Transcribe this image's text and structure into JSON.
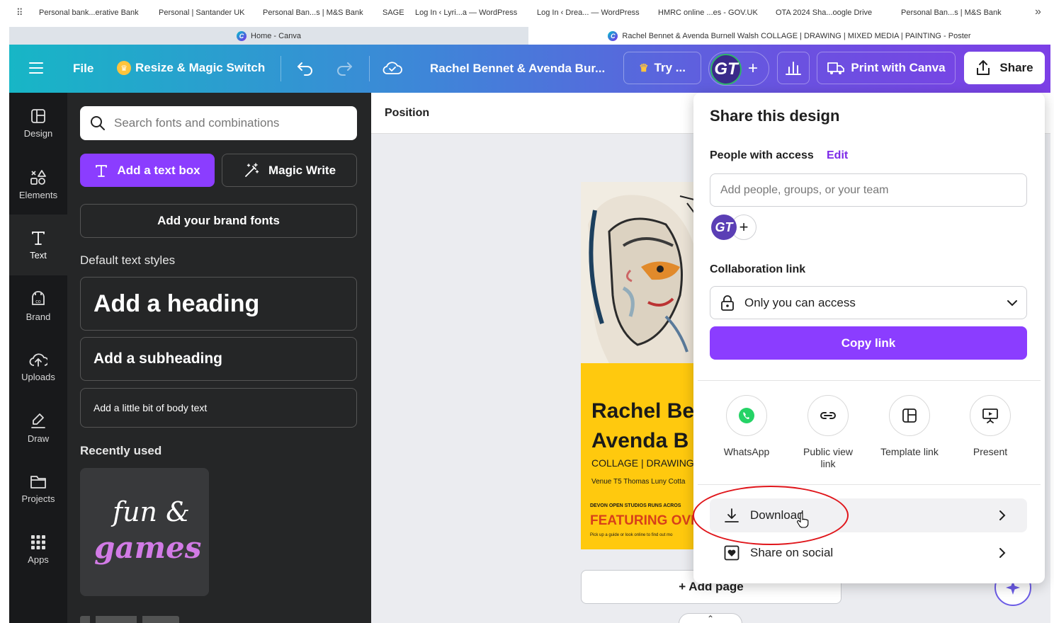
{
  "bookmarks": [
    "Personal bank...erative Bank",
    "Personal | Santander UK",
    "Personal Ban...s | M&S Bank",
    "SAGE",
    "Log In ‹ Lyri...a — WordPress",
    "Log In ‹ Drea... — WordPress",
    "HMRC online ...es - GOV.UK",
    "OTA 2024 Sha...oogle Drive",
    "Personal Ban...s | M&S Bank"
  ],
  "bookmarks_more": "»",
  "tabs": [
    {
      "title": "Home - Canva",
      "active": false
    },
    {
      "title": "Rachel Bennet & Avenda Burnell Walsh COLLAGE | DRAWING | MIXED MEDIA | PAINTING - Poster",
      "active": true
    }
  ],
  "header": {
    "file": "File",
    "resize": "Resize & Magic Switch",
    "doc_title": "Rachel Bennet & Avenda Bur...",
    "try": "Try ...",
    "avatar": "GT",
    "print": "Print with Canva",
    "share": "Share"
  },
  "rail": [
    {
      "label": "Design",
      "icon": "design-icon",
      "active": false
    },
    {
      "label": "Elements",
      "icon": "elements-icon",
      "active": false
    },
    {
      "label": "Text",
      "icon": "text-icon",
      "active": true
    },
    {
      "label": "Brand",
      "icon": "brand-icon",
      "active": false
    },
    {
      "label": "Uploads",
      "icon": "uploads-icon",
      "active": false
    },
    {
      "label": "Draw",
      "icon": "draw-icon",
      "active": false
    },
    {
      "label": "Projects",
      "icon": "projects-icon",
      "active": false
    },
    {
      "label": "Apps",
      "icon": "apps-icon",
      "active": false
    }
  ],
  "panel": {
    "search_placeholder": "Search fonts and combinations",
    "add_text_box": "Add a text box",
    "magic_write": "Magic Write",
    "brand_fonts": "Add your brand fonts",
    "default_styles": "Default text styles",
    "heading": "Add a heading",
    "subheading": "Add a subheading",
    "body": "Add a little bit of body text",
    "recent": "Recently used",
    "recent_item_line1": "fun &",
    "recent_item_line2": "games"
  },
  "canvas": {
    "position": "Position",
    "poster_name1": "Rachel Be",
    "poster_name2": "Avenda B",
    "poster_sub": "COLLAGE | DRAWING",
    "poster_venue": "Venue T5 Thomas Luny Cotta",
    "poster_small": "DEVON OPEN STUDIOS RUNS ACROS",
    "poster_feature": "FEATURING OVE",
    "poster_tiny": "Pick up a guide or look online to find out mo",
    "add_page": "+ Add page"
  },
  "share": {
    "title": "Share this design",
    "people_label": "People with access",
    "edit": "Edit",
    "add_people_placeholder": "Add people, groups, or your team",
    "avatar": "GT",
    "collab_label": "Collaboration link",
    "access": "Only you can access",
    "copy_link": "Copy link",
    "options": [
      {
        "label": "WhatsApp",
        "icon": "whatsapp-icon"
      },
      {
        "label": "Public view link",
        "icon": "link-icon"
      },
      {
        "label": "Template link",
        "icon": "template-icon"
      },
      {
        "label": "Present",
        "icon": "present-icon"
      }
    ],
    "download": "Download",
    "share_social": "Share on social"
  },
  "colors": {
    "accent": "#7d2ae8",
    "annotation": "#e0161b",
    "poster_yellow": "#ffc90e"
  }
}
